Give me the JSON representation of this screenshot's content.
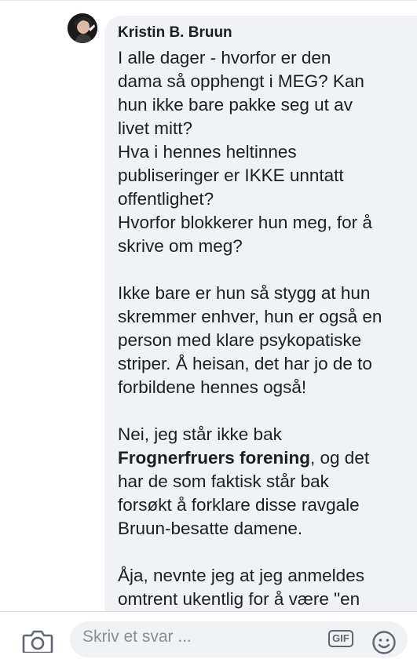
{
  "comment": {
    "author": "Kristin B. Bruun",
    "paragraphs": [
      [
        "I alle dager - hvorfor er den",
        "dama så opphengt i MEG? Kan",
        "hun ikke bare pakke seg ut av",
        "livet mitt?",
        "Hva i hennes heltinnes",
        "publiseringer er IKKE unntatt",
        "offentlighet?",
        "Hvorfor blokkerer hun meg, for å",
        "skrive om meg?"
      ],
      [
        "Ikke bare er hun så stygg at hun",
        "skremmer enhver, hun er også en",
        "person med klare psykopatiske",
        "striper. Å heisan, det har jo de to",
        "forbildene hennes også!"
      ],
      {
        "line1": "Nei, jeg står ikke bak",
        "mention": "Frognerfruers forening",
        "line2_rest": ", og det",
        "rest": [
          "har de som faktisk står bak",
          "forsøkt å forklare disse ravgale",
          "Bruun-besatte damene."
        ]
      },
      [
        "Åja, nevnte jeg at jeg anmeldes",
        "omtrent ukentlig for å være \"en"
      ]
    ]
  },
  "reply_bar": {
    "placeholder": "Skriv et svar ...",
    "gif_label": "GIF",
    "camera_icon": "camera-icon",
    "emoji_icon": "smiley-icon"
  },
  "colors": {
    "bubble": "#f0f2f5",
    "text": "#1c1e21",
    "icon": "#606770"
  }
}
